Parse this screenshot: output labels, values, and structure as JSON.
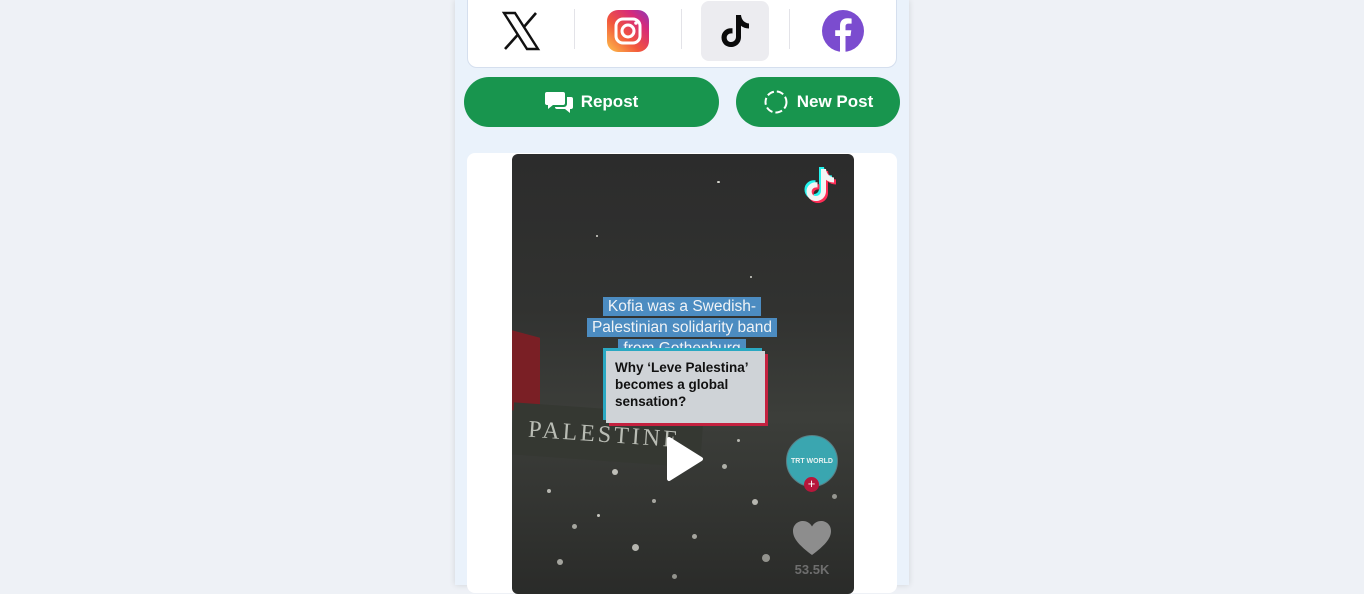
{
  "platforms": [
    {
      "name": "X",
      "icon": "x-logo-icon",
      "active": false
    },
    {
      "name": "Instagram",
      "icon": "instagram-icon",
      "active": false
    },
    {
      "name": "TikTok",
      "icon": "tiktok-icon",
      "active": true
    },
    {
      "name": "Facebook",
      "icon": "facebook-icon",
      "active": false
    }
  ],
  "actions": {
    "repost_label": "Repost",
    "new_post_label": "New Post"
  },
  "video": {
    "caption_top": "Kofia was a Swedish-Palestinian solidarity band from Gothenburg",
    "caption_main": "Why ‘Leve Palestina’ becomes a global sensation?",
    "banner_text": "PALESTINE",
    "channel_avatar_text": "TRT WORLD",
    "likes": "53.5K"
  },
  "colors": {
    "accent_green": "#18954e",
    "facebook_purple": "#7b4ccf",
    "active_tab_bg": "#ececf0"
  }
}
